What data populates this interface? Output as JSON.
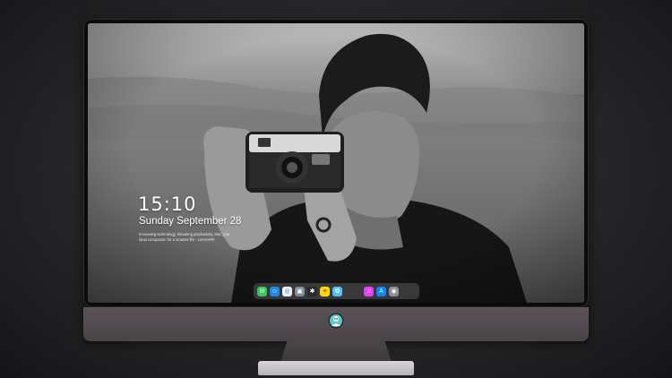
{
  "lock_screen": {
    "time": "15:10",
    "date": "Sunday September 28",
    "tagline": "Innovating technology, Elevating productivity, Mac your ideal companion for a smarter life - Lorem&#35;&#35;&#35;"
  },
  "dock": {
    "apps": [
      {
        "name": "messages",
        "icon": "messages-icon",
        "color": "#34c759",
        "glyph": "✉"
      },
      {
        "name": "finder",
        "icon": "finder-icon",
        "color": "#1e88e5",
        "glyph": "☺"
      },
      {
        "name": "safari",
        "icon": "safari-icon",
        "color": "#f2f2f2",
        "glyph": "◎"
      },
      {
        "name": "preview",
        "icon": "preview-icon",
        "color": "#7e8a9a",
        "glyph": "▣"
      },
      {
        "name": "finalcut",
        "icon": "clapper-icon",
        "color": "#2a2a2a",
        "glyph": "✱"
      },
      {
        "name": "notes",
        "icon": "notes-icon",
        "color": "#ffd60a",
        "glyph": "≡"
      },
      {
        "name": "photos",
        "icon": "photos-icon",
        "color": "#4cc2ff",
        "glyph": "✿"
      },
      {
        "name": "itunes",
        "icon": "music-icon",
        "color": "#e040fb",
        "glyph": "♫"
      },
      {
        "name": "appstore",
        "icon": "app-store-icon",
        "color": "#0a84ff",
        "glyph": "A"
      },
      {
        "name": "camera",
        "icon": "camera-icon",
        "color": "#8e8e93",
        "glyph": "◉"
      }
    ]
  },
  "colors": {
    "chin": "#4f494d",
    "stand_base": "#cfcacd",
    "dock_bg": "#464648"
  }
}
